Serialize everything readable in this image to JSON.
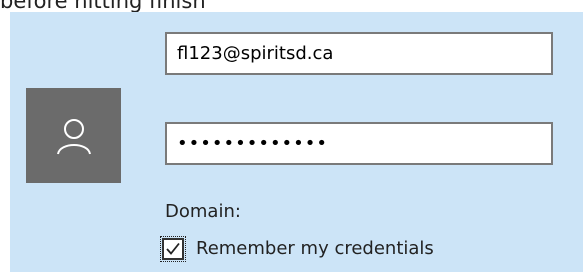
{
  "caption": "before hitting finish",
  "login": {
    "email_value": "fl123@spiritsd.ca",
    "password_value": "•••••••••••••",
    "domain_label": "Domain:",
    "remember_label": "Remember my credentials",
    "remember_checked": true,
    "avatar_icon": "user-icon",
    "checkbox_icon": "checkmark-icon"
  },
  "colors": {
    "panel_background": "#cce4f7",
    "avatar_background": "#6b6b6b",
    "field_border": "#7a7a7a"
  }
}
